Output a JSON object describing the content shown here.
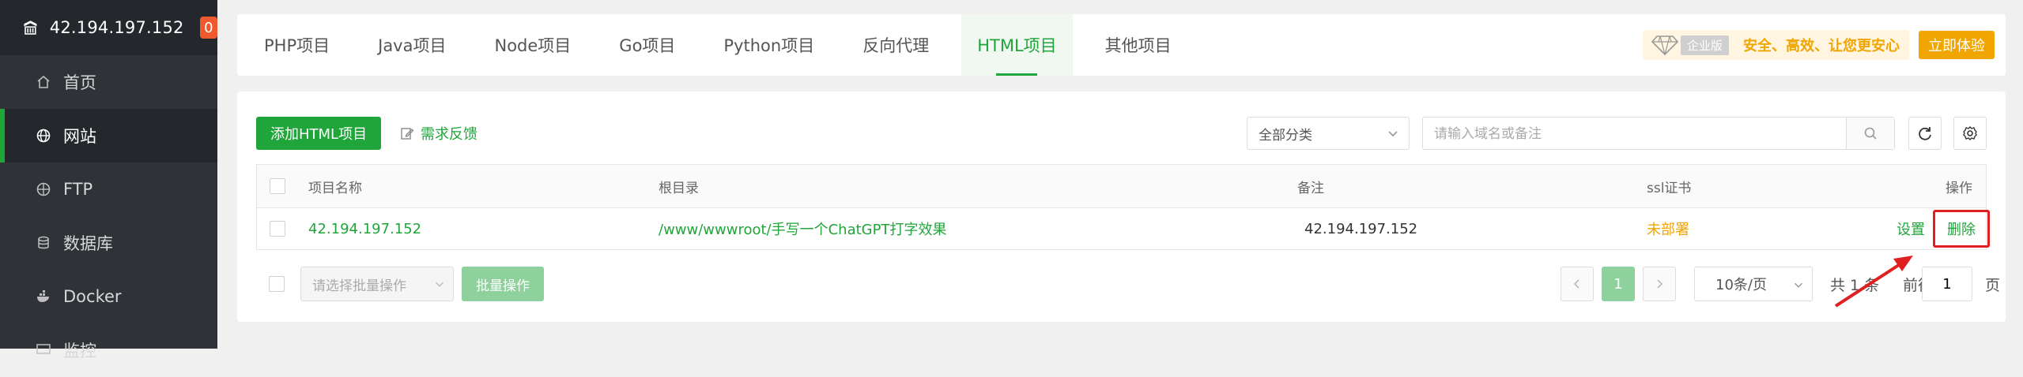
{
  "sidebar": {
    "host": "42.194.197.152",
    "badge": "0",
    "items": [
      {
        "label": "首页",
        "icon": "home-icon"
      },
      {
        "label": "网站",
        "icon": "globe-icon",
        "active": true
      },
      {
        "label": "FTP",
        "icon": "ftp-icon"
      },
      {
        "label": "数据库",
        "icon": "database-icon"
      },
      {
        "label": "Docker",
        "icon": "docker-icon"
      },
      {
        "label": "监控",
        "icon": "monitor-icon"
      }
    ]
  },
  "tabs": [
    "PHP项目",
    "Java项目",
    "Node项目",
    "Go项目",
    "Python项目",
    "反向代理",
    "HTML项目",
    "其他项目"
  ],
  "active_tab": "HTML项目",
  "promo": {
    "edition": "企业版",
    "slogan": "安全、高效、让您更安心",
    "button": "立即体验"
  },
  "toolbar": {
    "add_button": "添加HTML项目",
    "feedback": "需求反馈",
    "category": "全部分类",
    "search_placeholder": "请输入域名或备注"
  },
  "table": {
    "headers": {
      "name": "项目名称",
      "root": "根目录",
      "remark": "备注",
      "ssl": "ssl证书",
      "ops": "操作"
    },
    "rows": [
      {
        "name": "42.194.197.152",
        "root": "/www/wwwroot/手写一个ChatGPT打字效果",
        "remark": "42.194.197.152",
        "ssl": "未部署",
        "set": "设置",
        "delete": "删除"
      }
    ]
  },
  "footer": {
    "batch_placeholder": "请选择批量操作",
    "batch_button": "批量操作",
    "current_page": "1",
    "page_size": "10条/页",
    "total": "共 1 条",
    "goto_prefix": "前往",
    "goto_value": "1",
    "goto_suffix": "页"
  },
  "colors": {
    "accent": "#20a53a",
    "warning": "#f0a500",
    "sidebar_bg": "#2f3338",
    "badge": "#f0592d",
    "highlight": "#e02020"
  }
}
